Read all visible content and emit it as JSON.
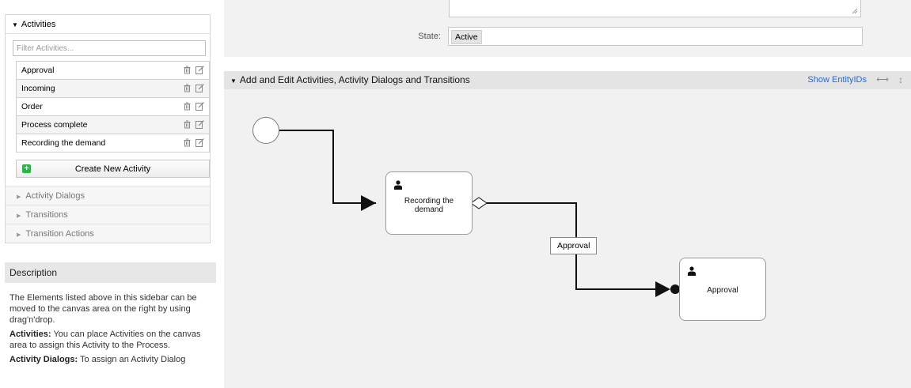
{
  "sidebar": {
    "activities_title": "Activities",
    "filter_placeholder": "Filter Activities...",
    "activities": [
      {
        "label": "Approval"
      },
      {
        "label": "Incoming"
      },
      {
        "label": "Order"
      },
      {
        "label": "Process complete"
      },
      {
        "label": "Recording the demand"
      }
    ],
    "create_button": "Create New Activity",
    "sections": [
      "Activity Dialogs",
      "Transitions",
      "Transition Actions"
    ]
  },
  "description": {
    "title": "Description",
    "intro": "The Elements listed above in this sidebar can be moved to the canvas area on the right by using drag'n'drop.",
    "activities_term": "Activities:",
    "activities_text": "You can place Activities on the canvas area to assign this Activity to the Process.",
    "dialogs_term": "Activity Dialogs:",
    "dialogs_text": "To assign an Activity Dialog"
  },
  "form": {
    "state_label": "State:",
    "state_value": "Active"
  },
  "canvas": {
    "header": "Add and Edit Activities, Activity Dialogs and Transitions",
    "show_entity_ids": "Show EntityIDs",
    "resize_h_icon": "⟷",
    "resize_v_icon": "↕",
    "nodes": {
      "recording": "Recording the demand",
      "approval": "Approval"
    },
    "transition_label": "Approval"
  },
  "icons": {
    "collapse": "triangle-down-icon",
    "expand": "triangle-right-icon",
    "delete": "trash-icon",
    "edit": "edit-icon",
    "add": "plus-icon",
    "person": "user-icon"
  },
  "colors": {
    "link": "#2a68c8",
    "add_green": "#2db34a",
    "header_bg": "#e4e4e4",
    "canvas_bg": "#f1f1f1"
  }
}
